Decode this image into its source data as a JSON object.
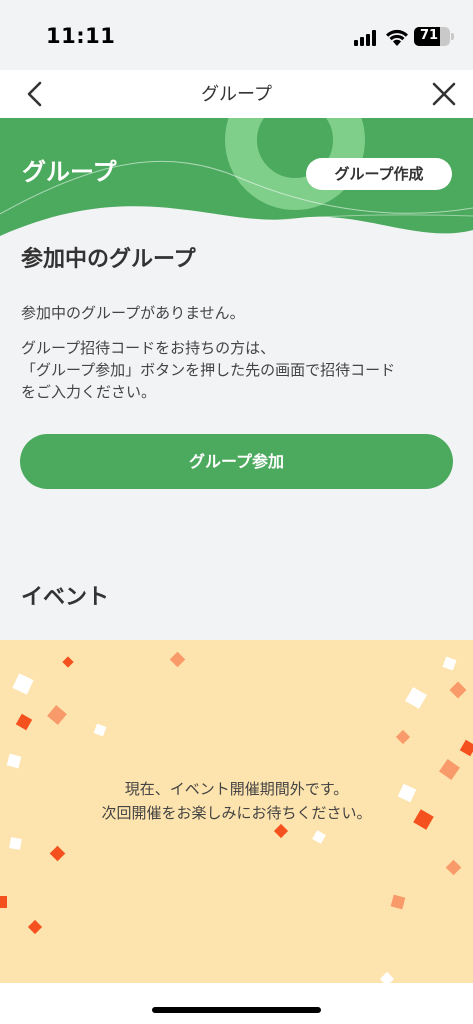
{
  "status_bar": {
    "time": "11:11",
    "battery_level": 71,
    "battery_text": "71"
  },
  "nav": {
    "title": "グループ",
    "back_icon": "chevron-left-icon",
    "close_icon": "close-icon"
  },
  "banner": {
    "title": "グループ",
    "create_button_label": "グループ作成",
    "color": "#4caa5e"
  },
  "joined_section": {
    "title": "参加中のグループ",
    "empty_message": "参加中のグループがありません。",
    "hint_lines": [
      "グループ招待コードをお持ちの方は、",
      "「グループ参加」ボタンを押した先の画面で招待コード",
      "をご入力ください。"
    ],
    "join_button_label": "グループ参加"
  },
  "event_section": {
    "title": "イベント",
    "message_lines": [
      "現在、イベント開催期間外です。",
      "次回開催をお楽しみにお待ちください。"
    ],
    "background_color": "#fde3ad"
  }
}
